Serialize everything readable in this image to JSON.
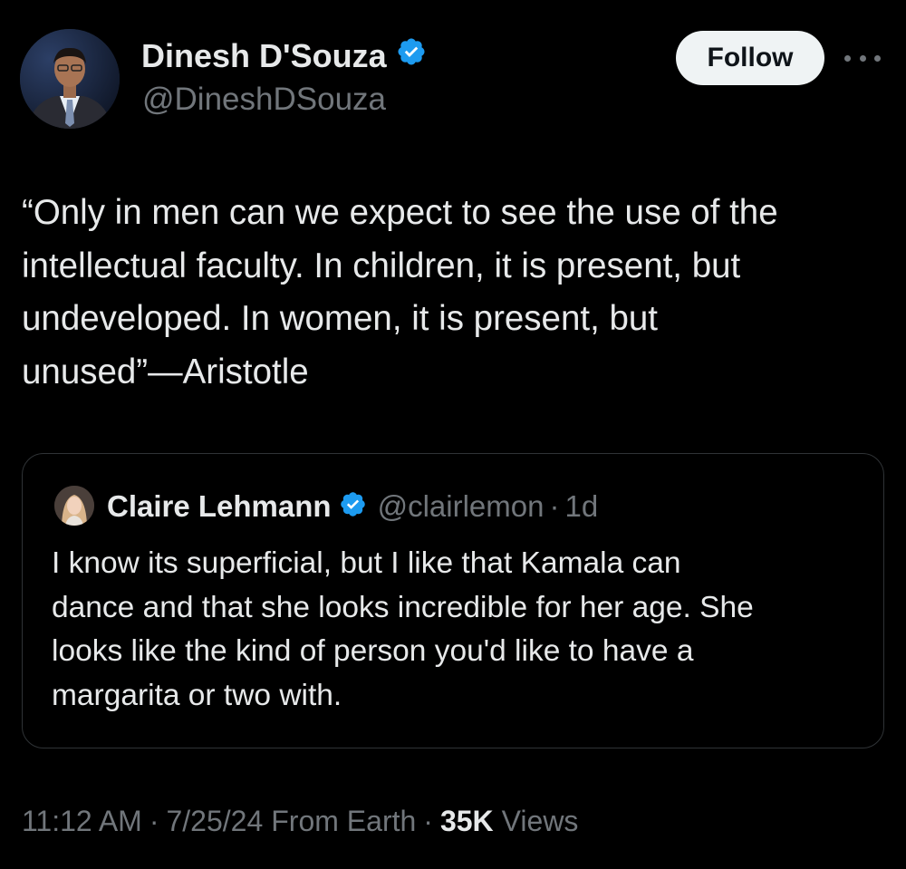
{
  "author": {
    "display_name": "Dinesh D'Souza",
    "handle": "@DineshDSouza",
    "verified": true
  },
  "actions": {
    "follow_label": "Follow",
    "more_icon": "more-horizontal-icon"
  },
  "tweet": {
    "text": "“Only in men can we expect to see the use of the\nintellectual faculty. In children, it is present, but\nundeveloped. In women, it is present, but\nunused”—Aristotle"
  },
  "quote": {
    "display_name": "Claire Lehmann",
    "handle": "@clairlemon",
    "separator": "·",
    "time": "1d",
    "verified": true,
    "text": "I know its superficial, but I like that Kamala can\ndance and that she looks incredible for her age. She\nlooks like the kind of person you'd like to have a\nmargarita or two with."
  },
  "meta": {
    "time": "11:12 AM",
    "separator": "·",
    "date": "7/25/24",
    "location": "From Earth",
    "views_count": "35K",
    "views_label": "Views"
  },
  "colors": {
    "background": "#000000",
    "primary_text": "#e7e9ea",
    "secondary_text": "#71767b",
    "verified_badge": "#1d9bf0",
    "border": "#2f3336",
    "follow_bg": "#eff3f4"
  }
}
